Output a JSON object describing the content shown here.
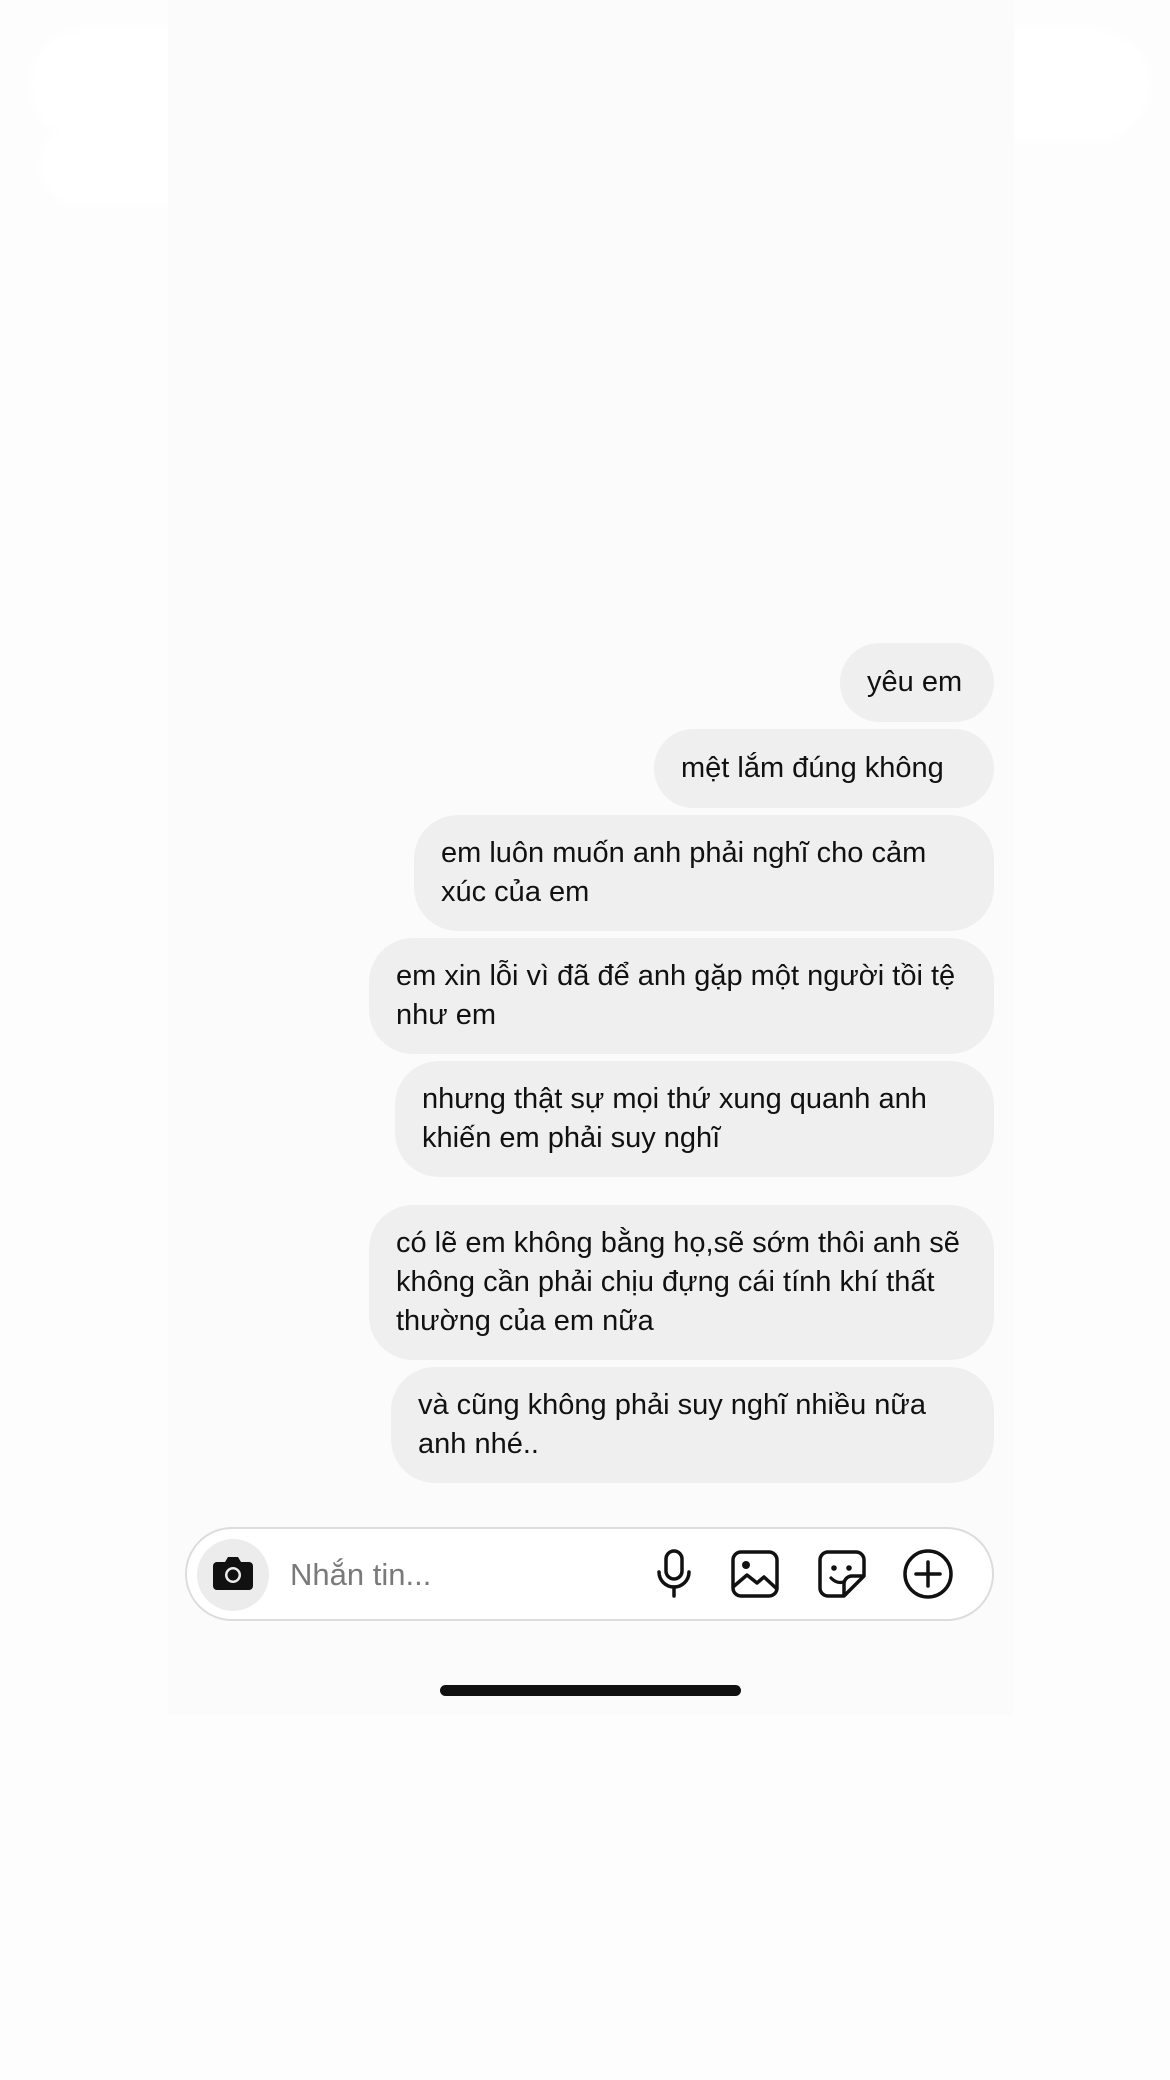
{
  "messages": [
    {
      "text": "yêu em"
    },
    {
      "text": "mệt lắm đúng không"
    },
    {
      "text": "em luôn muốn anh phải nghĩ cho cảm xúc của em"
    },
    {
      "text": "em xin lỗi vì đã để anh gặp một người tồi tệ như em"
    },
    {
      "text": "nhưng thật sự mọi thứ xung quanh anh khiến em phải suy nghĩ"
    },
    {
      "text": "có lẽ em không bằng họ,sẽ sớm thôi anh sẽ không cần phải chịu đựng cái tính khí thất thường của em nữa"
    },
    {
      "text": "và cũng không phải suy nghĩ nhiều nữa anh nhé.."
    }
  ],
  "composer": {
    "placeholder": "Nhắn tin...",
    "value": ""
  },
  "icons": {
    "camera": "camera-icon",
    "microphone": "microphone-icon",
    "gallery": "gallery-icon",
    "sticker": "sticker-icon",
    "add": "plus-circle-icon"
  },
  "colors": {
    "bubble": "#efefef",
    "text": "#111111",
    "placeholder": "#7a7a7a",
    "background": "#fdfdfd"
  }
}
